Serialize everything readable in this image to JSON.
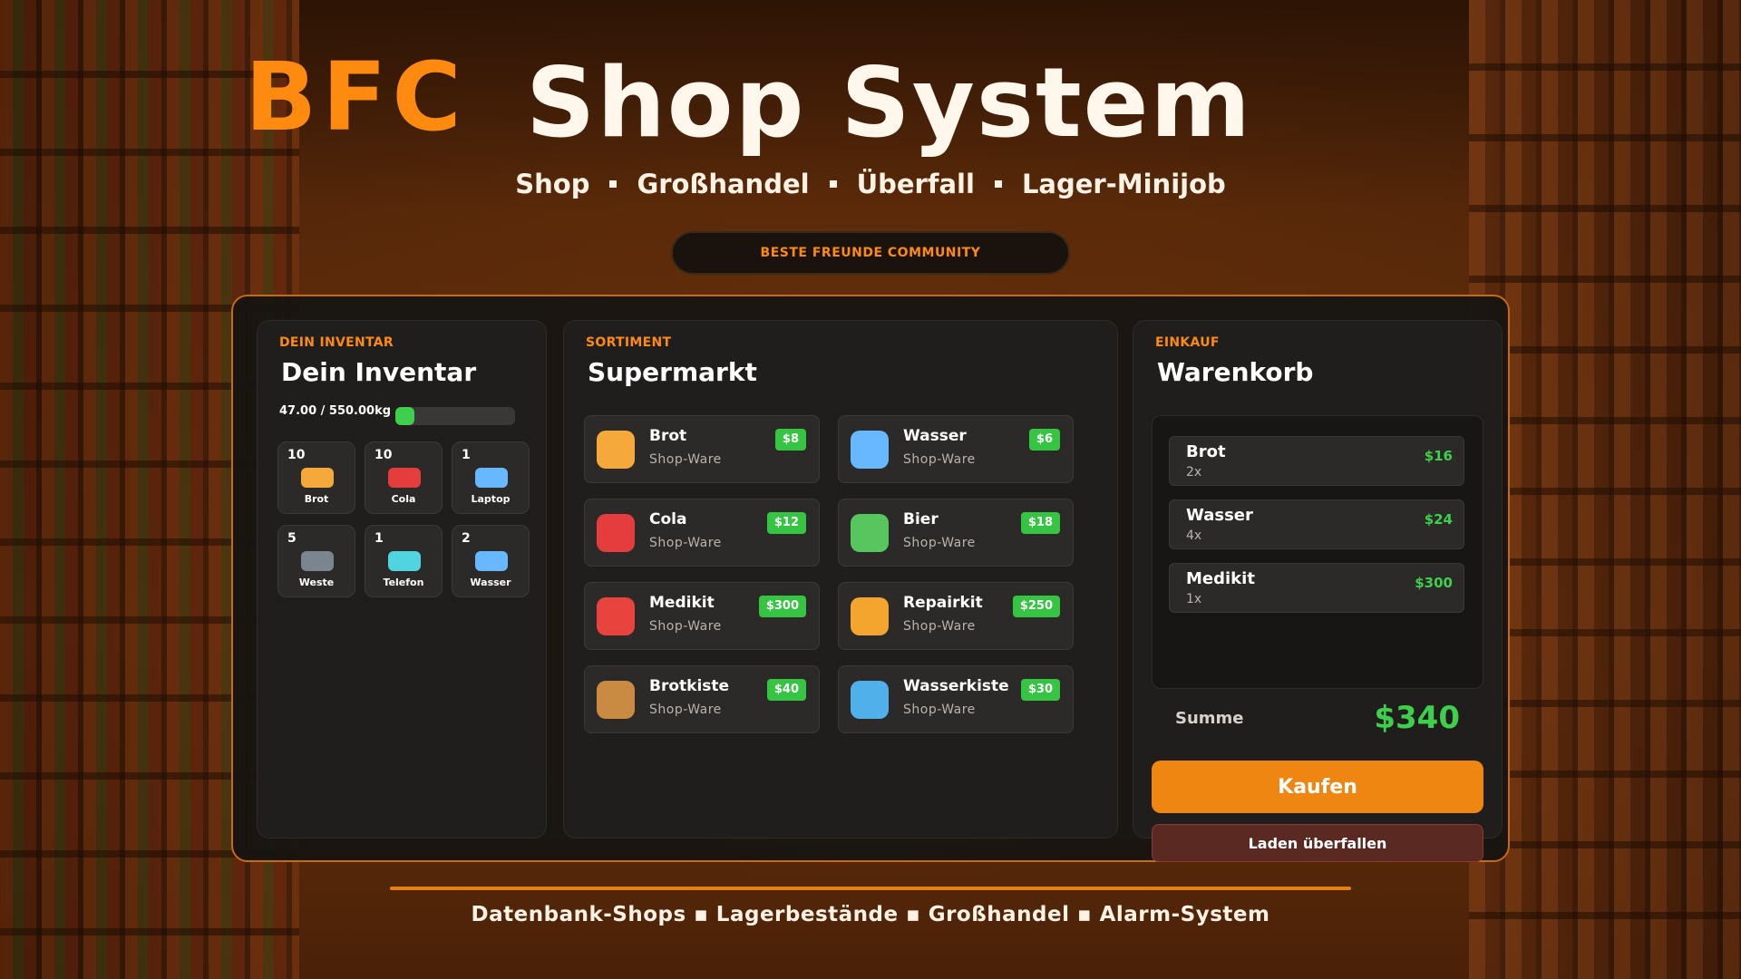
{
  "header": {
    "brand": "BFC",
    "title": "Shop System",
    "nav": [
      "Shop",
      "Großhandel",
      "Überfall",
      "Lager-Minijob"
    ],
    "community": "BESTE FREUNDE COMMUNITY"
  },
  "inventory": {
    "eyebrow": "DEIN INVENTAR",
    "title": "Dein Inventar",
    "weight_text": "47.00 / 550.00kg",
    "weight_fraction": 0.0855,
    "items": [
      {
        "qty": "10",
        "name": "Brot",
        "color": "#f5a93a"
      },
      {
        "qty": "10",
        "name": "Cola",
        "color": "#e53d3d"
      },
      {
        "qty": "1",
        "name": "Laptop",
        "color": "#67b8ff"
      },
      {
        "qty": "5",
        "name": "Weste",
        "color": "#7b8590"
      },
      {
        "qty": "1",
        "name": "Telefon",
        "color": "#4fd4e0"
      },
      {
        "qty": "2",
        "name": "Wasser",
        "color": "#67b8ff"
      }
    ]
  },
  "shop": {
    "eyebrow": "SORTIMENT",
    "title": "Supermarkt",
    "products": [
      {
        "name": "Brot",
        "sub": "Shop-Ware",
        "price": "$8",
        "color": "#f5a93a"
      },
      {
        "name": "Wasser",
        "sub": "Shop-Ware",
        "price": "$6",
        "color": "#67b8ff"
      },
      {
        "name": "Cola",
        "sub": "Shop-Ware",
        "price": "$12",
        "color": "#e53d3d"
      },
      {
        "name": "Bier",
        "sub": "Shop-Ware",
        "price": "$18",
        "color": "#58c65e"
      },
      {
        "name": "Medikit",
        "sub": "Shop-Ware",
        "price": "$300",
        "color": "#e8433d"
      },
      {
        "name": "Repairkit",
        "sub": "Shop-Ware",
        "price": "$250",
        "color": "#f3a52e"
      },
      {
        "name": "Brotkiste",
        "sub": "Shop-Ware",
        "price": "$40",
        "color": "#c98a42"
      },
      {
        "name": "Wasserkiste",
        "sub": "Shop-Ware",
        "price": "$30",
        "color": "#4fb0ea"
      }
    ]
  },
  "cart": {
    "eyebrow": "EINKAUF",
    "title": "Warenkorb",
    "items": [
      {
        "name": "Brot",
        "qty": "2x",
        "price": "$16"
      },
      {
        "name": "Wasser",
        "qty": "4x",
        "price": "$24"
      },
      {
        "name": "Medikit",
        "qty": "1x",
        "price": "$300"
      }
    ],
    "sum_label": "Summe",
    "sum_value": "$340",
    "buy_label": "Kaufen",
    "rob_label": "Laden überfallen"
  },
  "footer": {
    "text": "Datenbank-Shops ▪ Lagerbestände ▪ Großhandel ▪ Alarm-System"
  }
}
